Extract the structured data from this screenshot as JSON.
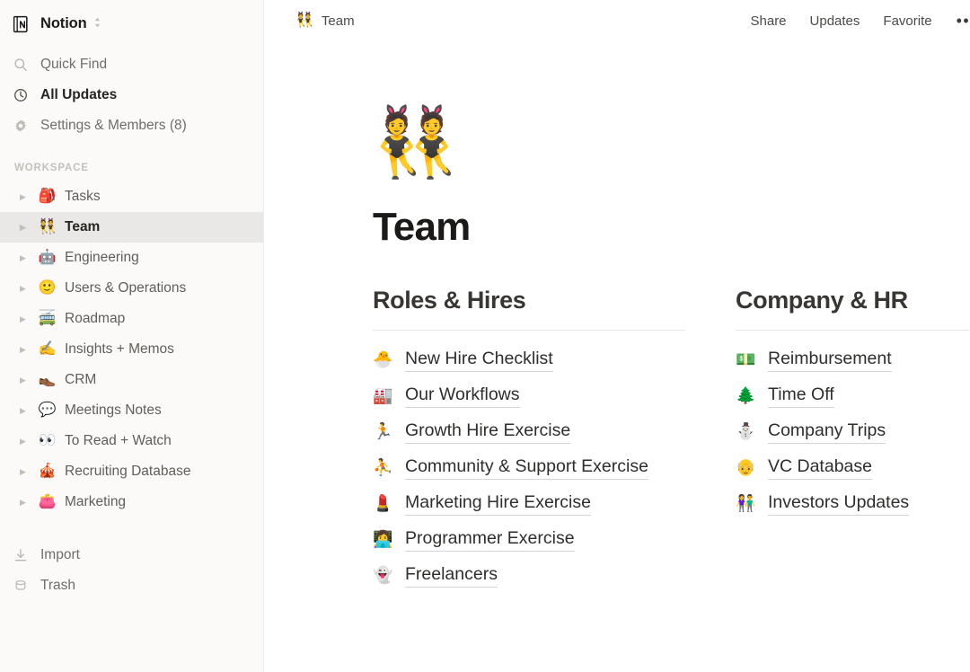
{
  "sidebar": {
    "workspace": {
      "name": "Notion",
      "logo_icon": "notion-notebook-icon",
      "caret_icon": "chevron-up-down-icon"
    },
    "top_nav": [
      {
        "label": "Quick Find",
        "icon": "search-icon",
        "bold": false
      },
      {
        "label": "All Updates",
        "icon": "clock-icon",
        "bold": true
      },
      {
        "label": "Settings & Members (8)",
        "icon": "gear-icon",
        "bold": false
      }
    ],
    "section_label": "WORKSPACE",
    "pages": [
      {
        "label": "Tasks",
        "emoji": "🎒",
        "active": false
      },
      {
        "label": "Team",
        "emoji": "👯",
        "active": true
      },
      {
        "label": "Engineering",
        "emoji": "🤖",
        "active": false
      },
      {
        "label": "Users & Operations",
        "emoji": "🙂",
        "active": false
      },
      {
        "label": "Roadmap",
        "emoji": "🚎",
        "active": false
      },
      {
        "label": "Insights + Memos",
        "emoji": "✍️",
        "active": false
      },
      {
        "label": "CRM",
        "emoji": "👞",
        "active": false
      },
      {
        "label": "Meetings Notes",
        "emoji": "💬",
        "active": false
      },
      {
        "label": "To Read + Watch",
        "emoji": "👀",
        "active": false
      },
      {
        "label": "Recruiting Database",
        "emoji": "🎪",
        "active": false
      },
      {
        "label": "Marketing",
        "emoji": "👛",
        "active": false
      }
    ],
    "bottom_nav": [
      {
        "label": "Import",
        "icon": "download-icon"
      },
      {
        "label": "Trash",
        "icon": "trash-icon"
      }
    ]
  },
  "topbar": {
    "breadcrumb_emoji": "👯",
    "breadcrumb_label": "Team",
    "share_label": "Share",
    "updates_label": "Updates",
    "favorite_label": "Favorite",
    "more_label": "•••"
  },
  "page": {
    "emoji": "👯",
    "title": "Team",
    "columns": [
      {
        "heading": "Roles & Hires",
        "links": [
          {
            "emoji": "🐣",
            "label": "New Hire Checklist"
          },
          {
            "emoji": "🏭",
            "label": "Our Workflows"
          },
          {
            "emoji": "🏃",
            "label": "Growth Hire Exercise"
          },
          {
            "emoji": "⛹️",
            "label": "Community & Support Exercise"
          },
          {
            "emoji": "💄",
            "label": "Marketing Hire Exercise"
          },
          {
            "emoji": "👩‍💻",
            "label": "Programmer Exercise"
          },
          {
            "emoji": "👻",
            "label": "Freelancers"
          }
        ]
      },
      {
        "heading": "Company & HR",
        "links": [
          {
            "emoji": "💵",
            "label": "Reimbursement"
          },
          {
            "emoji": "🌲",
            "label": "Time Off"
          },
          {
            "emoji": "⛄",
            "label": "Company Trips"
          },
          {
            "emoji": "👴",
            "label": "VC Database"
          },
          {
            "emoji": "👫",
            "label": "Investors Updates"
          }
        ]
      }
    ]
  },
  "colors": {
    "sidebar_bg": "#FBFAF9",
    "active_row_bg": "#E9E8E6",
    "text_primary": "#2f2e2c",
    "text_muted": "#6f6e6b",
    "rule": "#E7E6E3"
  }
}
